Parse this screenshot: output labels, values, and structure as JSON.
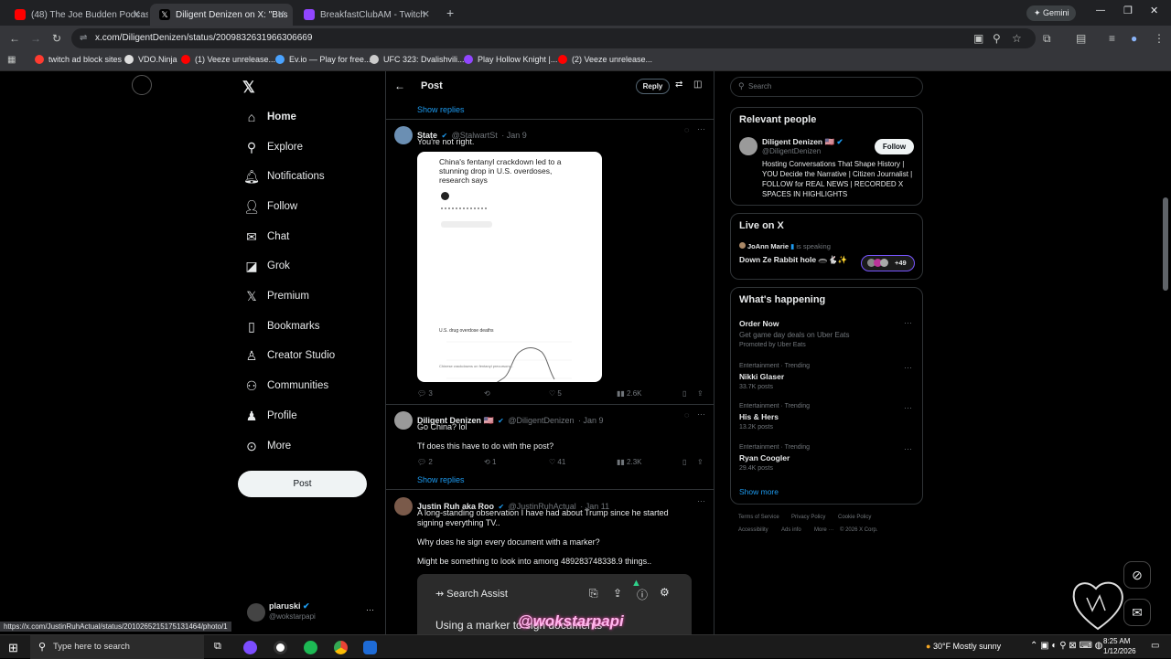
{
  "browser": {
    "tabs": [
      {
        "label": "(48) The Joe Budden Podcast E",
        "favicon_color": "#ff0000"
      },
      {
        "label": "Diligent Denizen on X: \"Bus",
        "favicon_color": "#ffffff"
      },
      {
        "label": "BreakfastClubAM - Twitch",
        "favicon_color": "#9146ff"
      }
    ],
    "new_tab": "+",
    "gemini_label": "Gemini",
    "url": "x.com/DiligentDenizen/status/2009832631966306669",
    "bookmarks": [
      {
        "label": "twitch ad block sites",
        "color": "#ff3b30"
      },
      {
        "label": "VDO.Ninja",
        "color": "#dddddd"
      },
      {
        "label": "(1) Veeze unrelease...",
        "color": "#ff0000"
      },
      {
        "label": "Ev.io — Play for free...",
        "color": "#4aa3ff"
      },
      {
        "label": "UFC 323: Dvalishvili...",
        "color": "#cccccc"
      },
      {
        "label": "Play Hollow Knight |...",
        "color": "#9146ff"
      },
      {
        "label": "(2) Veeze unrelease...",
        "color": "#ff0000"
      }
    ]
  },
  "nav": {
    "items": [
      {
        "label": "Home",
        "icon": "home-icon",
        "glyph": "⌂"
      },
      {
        "label": "Explore",
        "icon": "search-icon",
        "glyph": "⚲"
      },
      {
        "label": "Notifications",
        "icon": "bell-icon",
        "glyph": "🔔︎"
      },
      {
        "label": "Follow",
        "icon": "add-user-icon",
        "glyph": "👤︎"
      },
      {
        "label": "Chat",
        "icon": "mail-icon",
        "glyph": "✉"
      },
      {
        "label": "Grok",
        "icon": "grok-icon",
        "glyph": "◪"
      },
      {
        "label": "Premium",
        "icon": "x-logo-icon",
        "glyph": "𝕏"
      },
      {
        "label": "Bookmarks",
        "icon": "bookmark-icon",
        "glyph": "▯"
      },
      {
        "label": "Creator Studio",
        "icon": "creator-icon",
        "glyph": "♙"
      },
      {
        "label": "Communities",
        "icon": "communities-icon",
        "glyph": "⚇"
      },
      {
        "label": "Profile",
        "icon": "profile-icon",
        "glyph": "♟"
      },
      {
        "label": "More",
        "icon": "more-icon",
        "glyph": "⊙"
      }
    ],
    "post_label": "Post",
    "account": {
      "name": "plaruski",
      "handle": "@wokstarpapi"
    }
  },
  "post_header": {
    "title": "Post",
    "reply_label": "Reply"
  },
  "thread": {
    "show_replies_top": "Show replies",
    "tweet1": {
      "name": "State",
      "handle": "@StalwartSt",
      "date": "· Jan 9",
      "text": "You're not right.",
      "image": {
        "headline": "China's fentanyl crackdown led to a stunning drop in U.S. overdoses, research says",
        "chart_title": "U.S. drug overdose deaths",
        "footer": "Chinese crackdowns on fentanyl precursors..."
      },
      "replies": "3",
      "reposts": "",
      "likes": "5",
      "views": "2.6K"
    },
    "tweet2": {
      "name": "Diligent Denizen 🇺🇸",
      "handle": "@DiligentDenizen",
      "date": "· Jan 9",
      "text1": "Go China? lol",
      "text2": "Tf does this have to do with the post?",
      "replies": "2",
      "reposts": "1",
      "likes": "41",
      "views": "2.3K"
    },
    "show_replies_mid": "Show replies",
    "tweet3": {
      "name": "Justin Ruh aka Roo",
      "handle": "@JustinRuhActual",
      "date": "· Jan 11",
      "text1": "A long-standing observation I have had about Trump since he started signing everything TV..",
      "text2": "Why does he sign every document with a marker?",
      "text3": "Might be something to look into among 489283748338.9 things.."
    },
    "search_assist": {
      "label": "Search Assist",
      "text": "Using a marker to sign documents"
    }
  },
  "right": {
    "search_placeholder": "Search",
    "relevant": {
      "title": "Relevant people",
      "name": "Diligent Denizen 🇺🇸",
      "handle": "@DiligentDenizen",
      "follow": "Follow",
      "bio": "Hosting Conversations That Shape History | YOU Decide the Narrative | Citizen Journalist | FOLLOW for REAL NEWS | RECORDED X SPACES IN HIGHLIGHTS"
    },
    "live": {
      "title": "Live on X",
      "host": "JoAnn Marie",
      "status": "is speaking",
      "space": "Down Ze Rabbit hole 🕳️🐇✨",
      "count": "+49"
    },
    "happening": {
      "title": "What's happening",
      "items": [
        {
          "meta": "",
          "title": "Order Now",
          "sub": "Get game day deals on Uber Eats",
          "extra": "Promoted by Uber Eats"
        },
        {
          "meta": "Entertainment · Trending",
          "title": "Nikki Glaser",
          "sub": "33.7K posts"
        },
        {
          "meta": "Entertainment · Trending",
          "title": "His & Hers",
          "sub": "13.2K posts"
        },
        {
          "meta": "Entertainment · Trending",
          "title": "Ryan Coogler",
          "sub": "29.4K posts"
        }
      ],
      "show_more": "Show more"
    },
    "footer": [
      "Terms of Service",
      "Privacy Policy",
      "Cookie Policy",
      "Accessibility",
      "Ads info",
      "More ···",
      "© 2026 X Corp."
    ]
  },
  "status_url": "https://x.com/JustinRuhActual/status/2010265215175131464/photo/1",
  "overlay_text": "@wokstarpapi",
  "taskbar": {
    "search_placeholder": "Type here to search",
    "weather": "30°F  Mostly sunny",
    "time": "8:25 AM",
    "date": "1/12/2026"
  }
}
